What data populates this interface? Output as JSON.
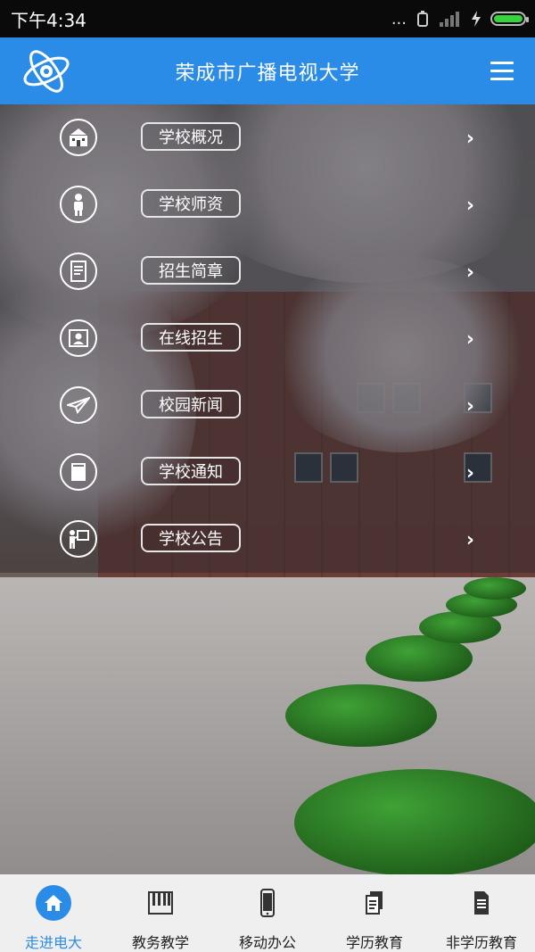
{
  "status_bar": {
    "time": "下午4:34",
    "indicators": "..."
  },
  "header": {
    "title": "荣成市广播电视大学",
    "logo_icon": "atom-logo-icon",
    "menu_icon": "hamburger-menu-icon"
  },
  "menu": {
    "items": [
      {
        "label": "学校概况",
        "icon": "school-building-icon"
      },
      {
        "label": "学校师资",
        "icon": "teacher-icon"
      },
      {
        "label": "招生简章",
        "icon": "document-icon"
      },
      {
        "label": "在线招生",
        "icon": "id-card-icon"
      },
      {
        "label": "校园新闻",
        "icon": "paper-plane-icon"
      },
      {
        "label": "学校通知",
        "icon": "notice-icon"
      },
      {
        "label": "学校公告",
        "icon": "presentation-icon"
      }
    ],
    "chevron": "›"
  },
  "bottom_nav": {
    "tabs": [
      {
        "label": "走进电大",
        "icon": "home-icon",
        "active": true
      },
      {
        "label": "教务教学",
        "icon": "piano-keys-icon",
        "active": false
      },
      {
        "label": "移动办公",
        "icon": "phone-icon",
        "active": false
      },
      {
        "label": "学历教育",
        "icon": "documents-icon",
        "active": false
      },
      {
        "label": "非学历教育",
        "icon": "document-icon",
        "active": false
      }
    ]
  },
  "colors": {
    "accent": "#2a8ce6",
    "status_bar": "#0a0a0a",
    "nav_bg": "#efefef",
    "battery": "#35d43a"
  }
}
